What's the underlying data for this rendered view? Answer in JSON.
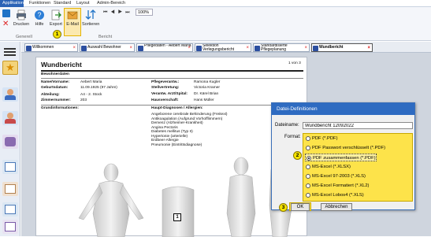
{
  "ribbon_tabs": [
    "Applikation",
    "Funktionen",
    "Standard",
    "Layout",
    "Admin-Bereich"
  ],
  "ribbon": {
    "print": "Drucken",
    "help": "Hilfe",
    "export": "Export",
    "email": "E-Mail",
    "sort": "Sortieren",
    "zoom": "100%",
    "group_general": "Generell",
    "group_report": "Bericht"
  },
  "doc_tabs": [
    "Willkommen",
    "Auswahl Bewohner",
    "Pflegedaten - Aebert Maria",
    "Selektion Verlegungsbericht",
    "Standardisierte Pflegeplanung",
    "Wundbericht"
  ],
  "report": {
    "title": "Wundbericht",
    "page": "1 von 3",
    "section": "Bewohnerdaten",
    "name_label": "Name/Vorname:",
    "name": "Aebert Maria",
    "birth_label": "Geburtsdatum:",
    "birth": "11.09.1925 (97 Jahre)",
    "dept_label": "Abteilung:",
    "dept": "A4 - 2. Stock",
    "room_label": "Zimmernummer:",
    "room": "203",
    "care_label": "Pflegeverantw.:",
    "care": "Ramona Kugler",
    "deputy_label": "Stellvertretung:",
    "deputy": "Victoria Kramer",
    "doctor_label": "Verantw. Arzt/Spital:",
    "doctor": "Dr. Kärel Brian",
    "gp_label": "Hausverschaft:",
    "gp": "Hans Müller",
    "basic_label": "Grundinformationen:",
    "diag_label": "Haupt-Diagnosen / Allergien:",
    "diagnoses": [
      "Angeborene cerebrale Behinderung (Freitext)",
      "Antikoagulation (Aufgrund Vorhofflimmern)",
      "Demenz (Alzheimer-Krankheit)",
      "Angina Pectoris",
      "Diabetes mellitus (Typ II)",
      "Hypertonie (arterielle)",
      "Erdbeer-Allergie",
      "Pneumonie (Eintrittsdiagnose)"
    ],
    "marker": "1"
  },
  "dialog": {
    "title": "Datei-Definitionen",
    "filename_label": "Dateiname:",
    "filename": "Wundbericht 12092022",
    "format_label": "Format:",
    "options": [
      "PDF (*.PDF)",
      "PDF Passwort verschlüsselt (*.PDF)",
      "PDF zusammenfassen (*.PDF)",
      "MS-Excel (*.XLSX)",
      "MS-Excel 97-2003 (*.XLS)",
      "MS-Excel Formatiert (*.XL2)",
      "MS-Excel Lobos4 (*.XLS)"
    ],
    "selected_index": 2,
    "ok": "OK",
    "cancel": "Abbrechen"
  },
  "badges": [
    "1",
    "2",
    "3"
  ],
  "colors": {
    "accent": "#2e6bc1",
    "highlight": "#fde34a"
  }
}
